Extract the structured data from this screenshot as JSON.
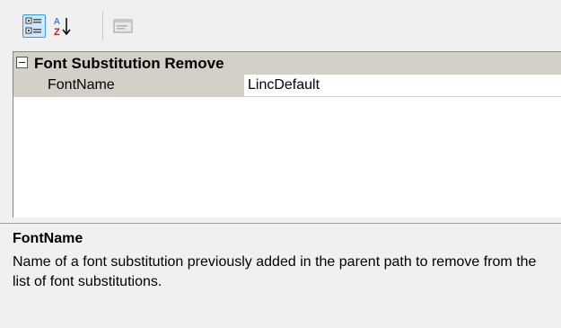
{
  "toolbar": {
    "categorized_icon": "categorized-view-icon",
    "alphabetical_icon": "sort-alphabetical-icon",
    "property_pages_icon": "property-pages-icon"
  },
  "grid": {
    "category": {
      "label": "Font Substitution Remove",
      "expanded": true
    },
    "properties": [
      {
        "name": "FontName",
        "value": "LincDefault"
      }
    ]
  },
  "description": {
    "title": "FontName",
    "text": "Name of a font substitution previously added in the parent path to remove from the list of font substitutions."
  },
  "colors": {
    "selected_button_border": "#3399ff",
    "selected_button_bg": "#cce8ff",
    "category_bg": "#d4d0c8",
    "panel_bg": "#f0f0f0",
    "value_bg": "#ffffff"
  }
}
